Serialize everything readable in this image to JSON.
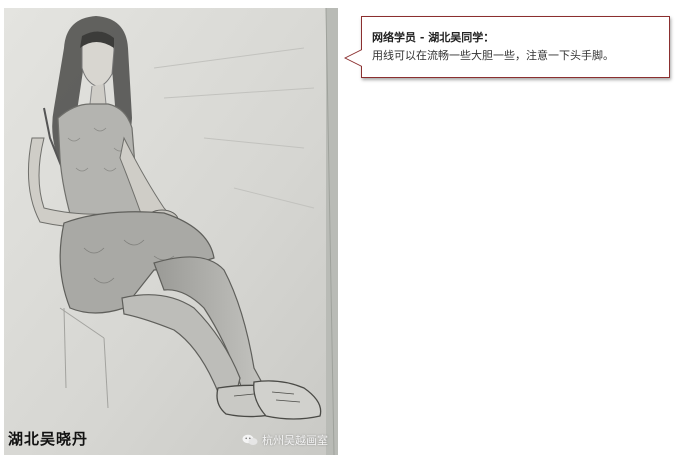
{
  "artwork": {
    "caption": "湖北吴晓丹",
    "watermark": "杭州吴越画室",
    "watermark_icon": "wechat-icon"
  },
  "comment": {
    "title": "网络学员 - 湖北吴同学：",
    "body": "用线可以在流畅一些大胆一些，注意一下头手脚。",
    "border_color": "#8b2f2f"
  }
}
